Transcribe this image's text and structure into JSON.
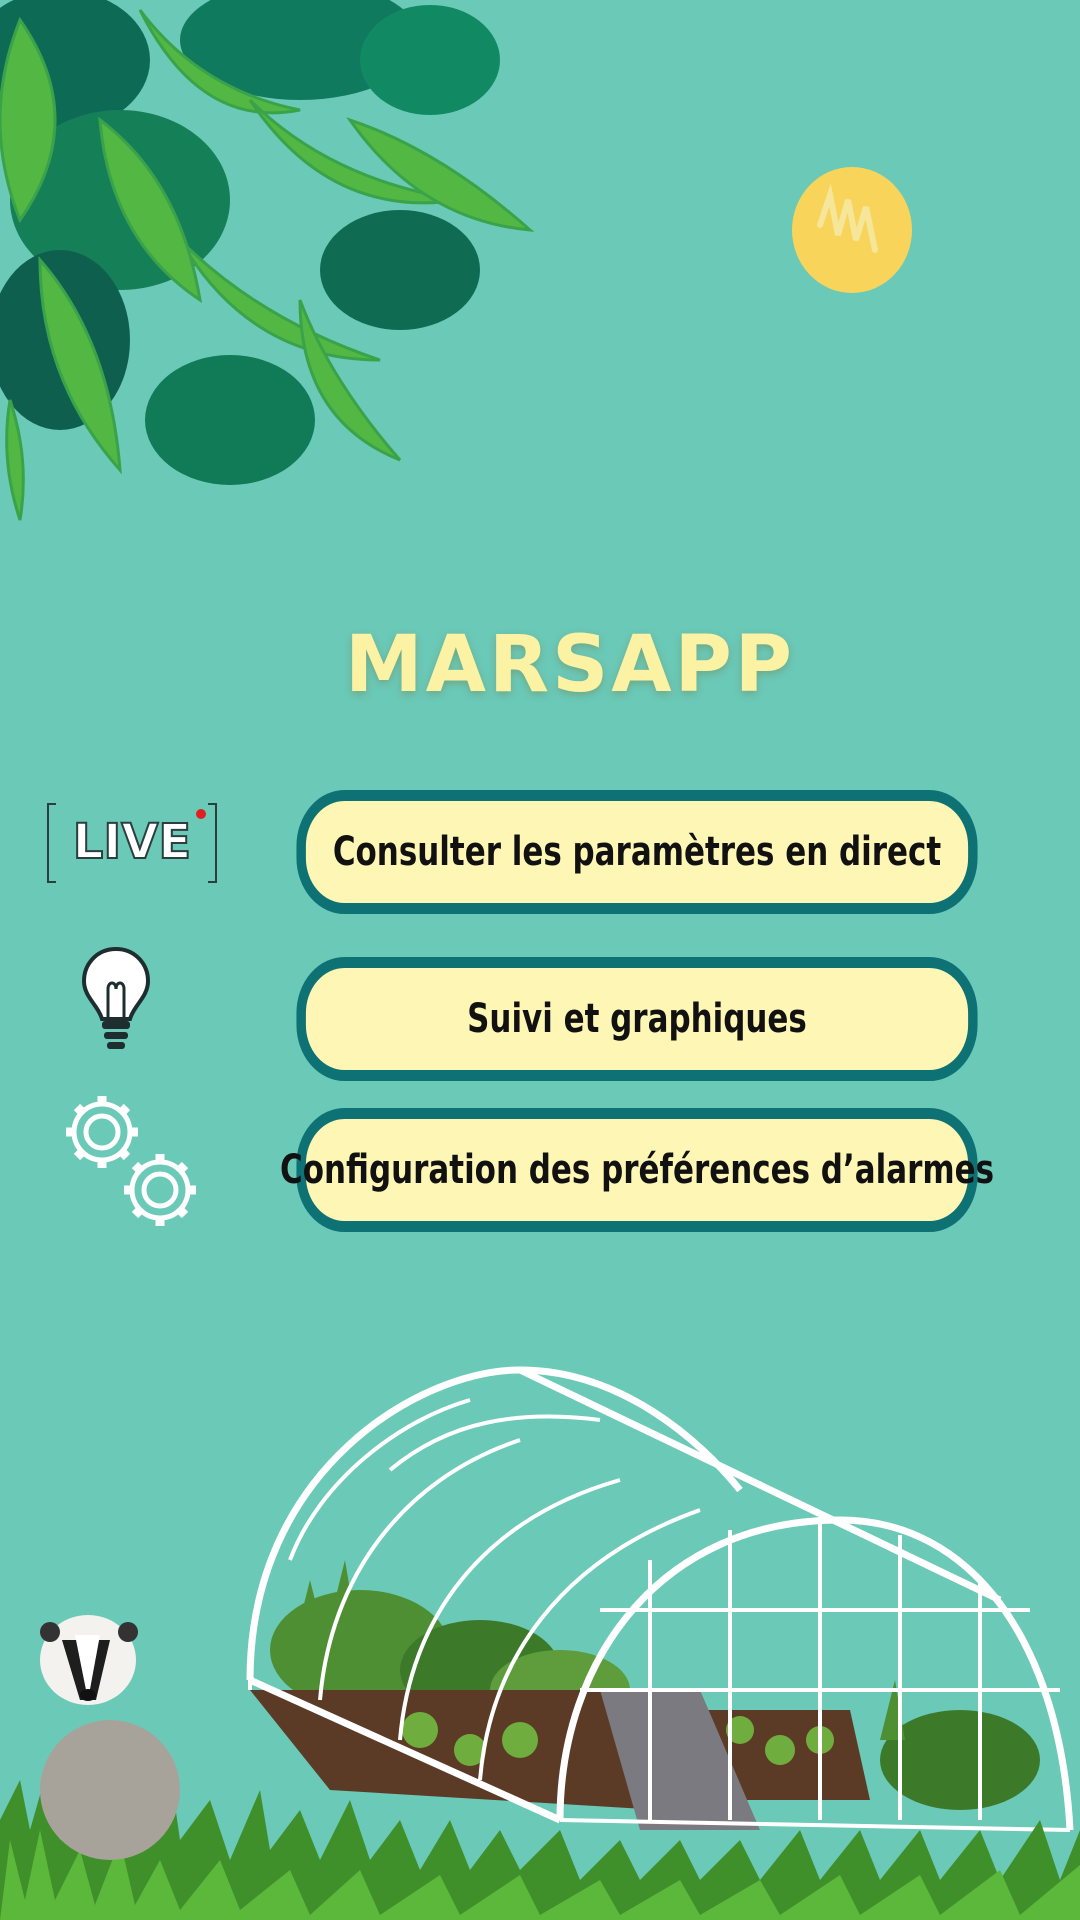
{
  "app": {
    "title": "MARSAPP"
  },
  "menu": {
    "items": [
      {
        "label": "Consulter les paramètres en direct",
        "icon": "live-icon"
      },
      {
        "label": "Suivi et graphiques",
        "icon": "lightbulb-icon"
      },
      {
        "label": "Configuration des préférences d’alarmes",
        "icon": "gears-icon"
      }
    ],
    "live_badge": "LIVE"
  },
  "colors": {
    "background": "#6bc9b8",
    "title": "#fbf2a4",
    "button_fill": "#fef6b5",
    "button_border": "#0e7274",
    "sun": "#f9d45a"
  }
}
